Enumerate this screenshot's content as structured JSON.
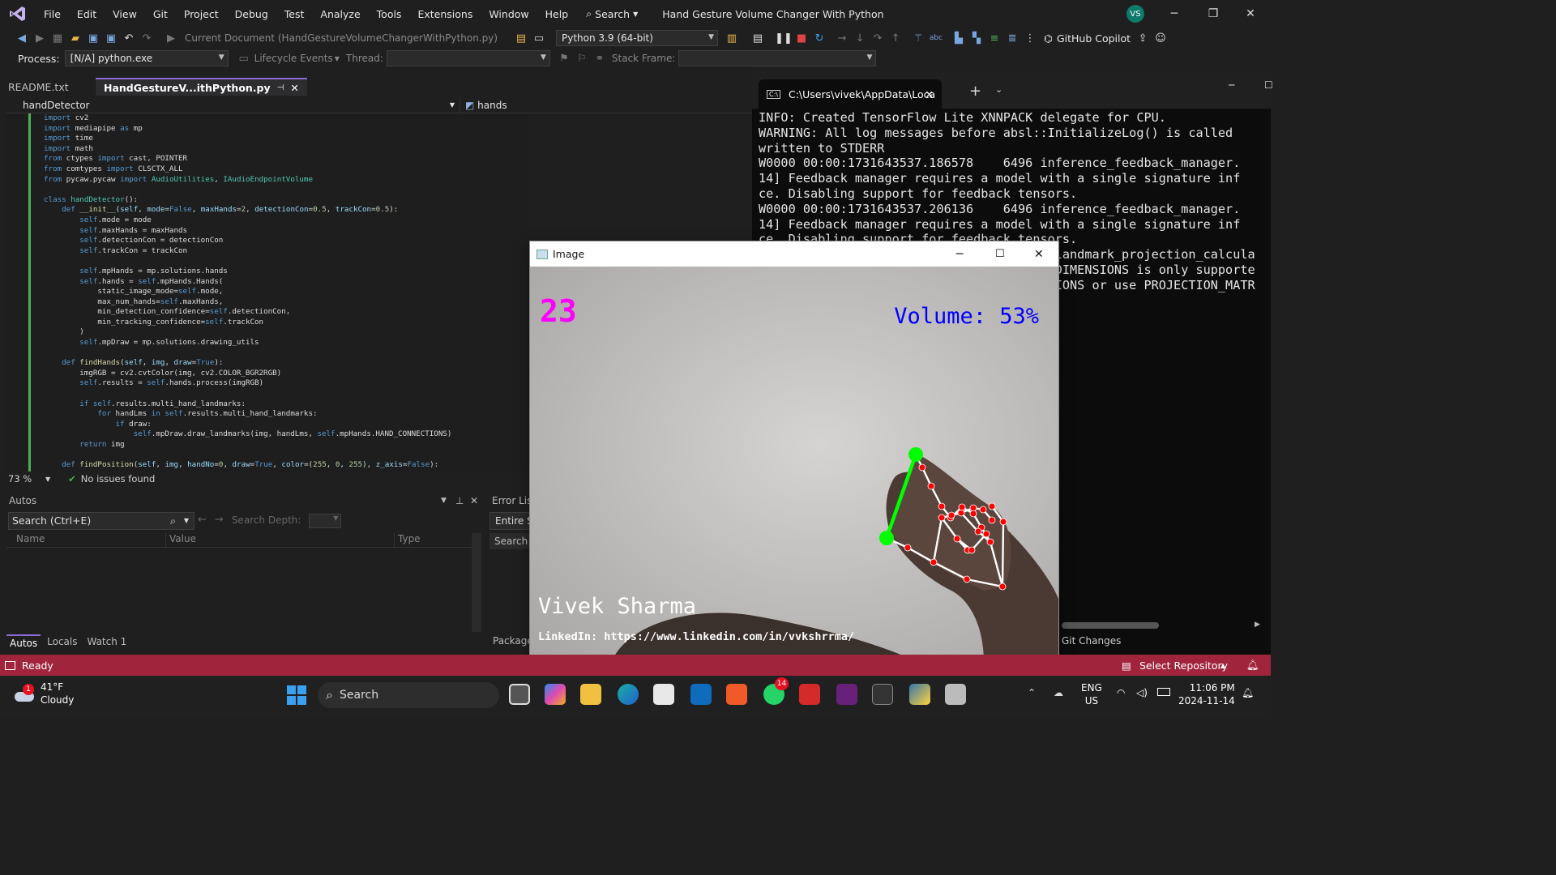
{
  "titlebar": {
    "menus": [
      "File",
      "Edit",
      "View",
      "Git",
      "Project",
      "Debug",
      "Test",
      "Analyze",
      "Tools",
      "Extensions",
      "Window",
      "Help"
    ],
    "search_label": "Search",
    "title": "Hand Gesture Volume Changer With Python",
    "avatar_initials": "VS"
  },
  "toolbar": {
    "current_document": "Current Document (HandGestureVolumeChangerWithPython.py)",
    "python_env": "Python 3.9 (64-bit)",
    "copilot": "GitHub Copilot",
    "process_label": "Process:",
    "process_value": "[N/A] python.exe",
    "lifecycle_label": "Lifecycle Events",
    "thread_label": "Thread:",
    "stack_frame_label": "Stack Frame:"
  },
  "editor": {
    "tabs": [
      {
        "label": "README.txt",
        "active": false
      },
      {
        "label": "HandGestureV...ithPython.py",
        "active": true
      }
    ],
    "nav_left": "handDetector",
    "nav_right": "hands",
    "zoom": "73 %",
    "issues": "No issues found"
  },
  "autos": {
    "title": "Autos",
    "search_placeholder": "Search (Ctrl+E)",
    "search_depth": "Search Depth:",
    "columns": [
      "Name",
      "Value",
      "Type"
    ],
    "tabs": [
      "Autos",
      "Locals",
      "Watch 1"
    ]
  },
  "errorlist": {
    "title": "Error List",
    "scope": "Entire S",
    "search": "Search E",
    "bottom": "Package"
  },
  "terminal": {
    "tab_title": "C:\\Users\\vivek\\AppData\\Loca",
    "lines": [
      "INFO: Created TensorFlow Lite XNNPACK delegate for CPU.",
      "WARNING: All log messages before absl::InitializeLog() is called",
      "written to STDERR",
      "W0000 00:00:1731643537.186578    6496 inference_feedback_manager.",
      "14] Feedback manager requires a model with a single signature inf",
      "ce. Disabling support for feedback tensors.",
      "W0000 00:00:1731643537.206136    6496 inference_feedback_manager.",
      "14] Feedback manager requires a model with a single signature inf",
      "ce. Disabling support for feedback tensors.",
      "                                        landmark_projection_calcula",
      "                                        DIMENSIONS is only supporte",
      "                                        IONS or use PROJECTION_MATR"
    ],
    "git_changes": "Git Changes"
  },
  "cv_window": {
    "title": "Image",
    "fps": "23",
    "volume": "Volume: 53%",
    "name": "Vivek Sharma",
    "linkedin": "LinkedIn: https://www.linkedin.com/in/vvkshrrma/",
    "volume_percent": 53
  },
  "status": {
    "ready": "Ready",
    "select_repo": "Select Repository"
  },
  "taskbar": {
    "temp": "41°F",
    "weather": "Cloudy",
    "weather_badge": "1",
    "search": "Search",
    "whatsapp_badge": "14",
    "lang1": "ENG",
    "lang2": "US",
    "time": "11:06 PM",
    "date": "2024-11-14"
  },
  "colors": {
    "vs_status": "#a1243d",
    "accent": "#8a6bd6",
    "fps_magenta": "#ff00ff",
    "volume_blue": "#0000ff",
    "landmark_red": "#ff0000",
    "line_green": "#00ff00"
  }
}
